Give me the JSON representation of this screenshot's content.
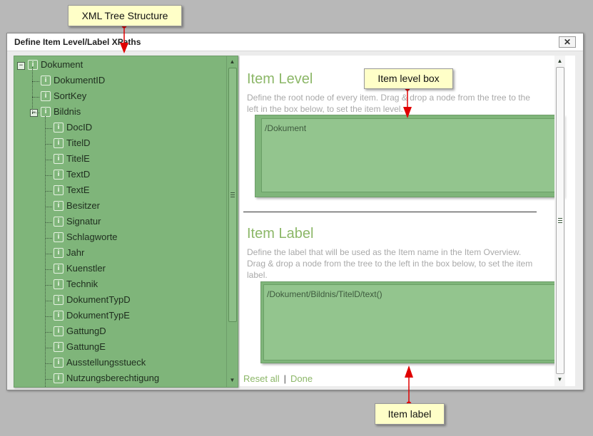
{
  "dialog": {
    "title": "Define Item Level/Label XPaths",
    "close_symbol": "✕"
  },
  "tree": {
    "expand_symbol": "−",
    "node_icon_glyph": "i",
    "items": [
      {
        "label": "Dokument",
        "level": 0,
        "expander": true
      },
      {
        "label": "DokumentID",
        "level": 1
      },
      {
        "label": "SortKey",
        "level": 1
      },
      {
        "label": "Bildnis",
        "level": 1,
        "expander": true
      },
      {
        "label": "DocID",
        "level": 2
      },
      {
        "label": "TitelD",
        "level": 2
      },
      {
        "label": "TitelE",
        "level": 2
      },
      {
        "label": "TextD",
        "level": 2
      },
      {
        "label": "TextE",
        "level": 2
      },
      {
        "label": "Besitzer",
        "level": 2
      },
      {
        "label": "Signatur",
        "level": 2
      },
      {
        "label": "Schlagworte",
        "level": 2
      },
      {
        "label": "Jahr",
        "level": 2
      },
      {
        "label": "Kuenstler",
        "level": 2
      },
      {
        "label": "Technik",
        "level": 2
      },
      {
        "label": "DokumentTypD",
        "level": 2
      },
      {
        "label": "DokumentTypE",
        "level": 2
      },
      {
        "label": "GattungD",
        "level": 2
      },
      {
        "label": "GattungE",
        "level": 2
      },
      {
        "label": "Ausstellungsstueck",
        "level": 2
      },
      {
        "label": "Nutzungsberechtigung",
        "level": 2
      }
    ]
  },
  "item_level": {
    "title": "Item Level",
    "description": "Define the root node of every item. Drag & drop a node from the tree to the left in the box below, to set the item level.",
    "value": "/Dokument"
  },
  "item_label": {
    "title": "Item Label",
    "description": "Define the label that will be used as the Item name in the Item Overview. Drag & drop a node from the tree to the left in the box below, to set the item label.",
    "value": "/Dokument/Bildnis/TitelD/text()"
  },
  "footer": {
    "reset_all": "Reset all",
    "separator": "|",
    "done": "Done"
  },
  "annotations": {
    "tree_structure": "XML Tree Structure",
    "item_level_box": "Item level box",
    "item_label": "Item label"
  },
  "colors": {
    "tree_green": "#7fb57a",
    "heading_green": "#8cb768",
    "callout_yellow": "#ffffc8",
    "arrow_red": "#e00000"
  }
}
